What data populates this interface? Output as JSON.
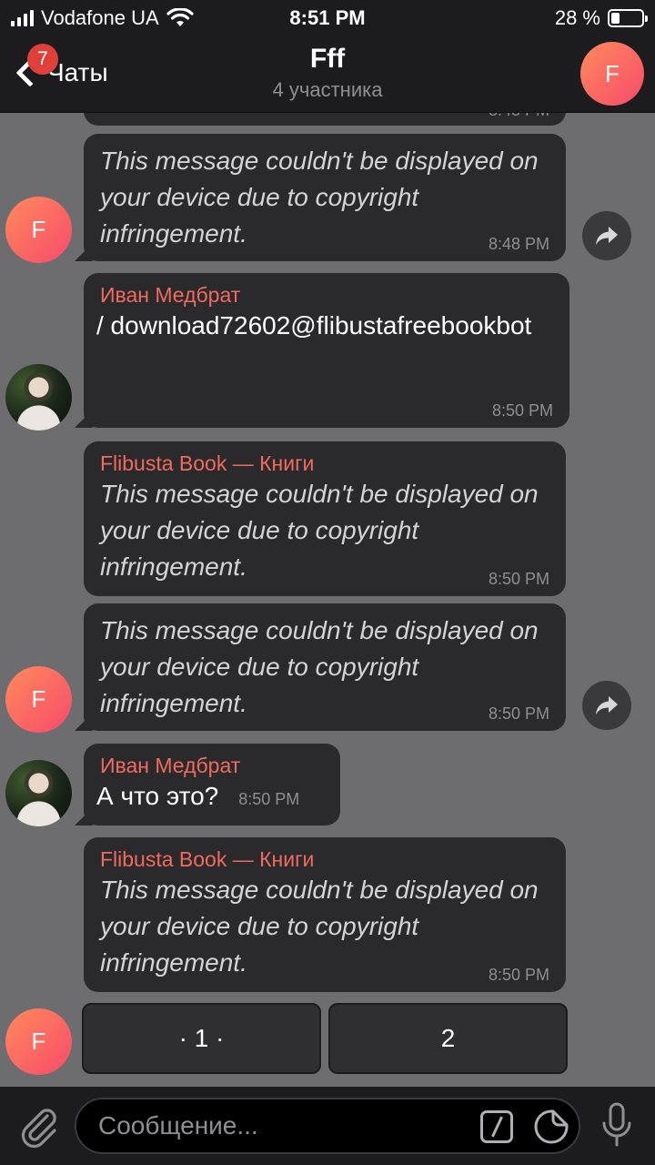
{
  "status_bar": {
    "carrier": "Vodafone UA",
    "time": "8:51 PM",
    "battery_percent": "28 %",
    "battery_level": 0.28
  },
  "header": {
    "back_label": "Чаты",
    "unread_count": "7",
    "title": "Fff",
    "subtitle": "4 участника",
    "avatar_letter": "F"
  },
  "messages": {
    "partial_time": "8:48 PM",
    "m1": {
      "text": "This message couldn't be displayed on your device due to copyright infringement.",
      "time": "8:48 PM",
      "avatar": "F"
    },
    "m2": {
      "sender": "Иван Медбрат",
      "text": "/ download72602@flibustafreebookbot",
      "time": "8:50 PM"
    },
    "m3": {
      "sender": "Flibusta Book — Книги",
      "text": "This message couldn't be displayed on your device due to copyright infringement.",
      "time": "8:50 PM"
    },
    "m4": {
      "text": "This message couldn't be displayed on your device due to copyright infringement.",
      "time": "8:50 PM",
      "avatar": "F"
    },
    "m5": {
      "sender": "Иван Медбрат",
      "text": "А что это?",
      "time": "8:50 PM"
    },
    "m6": {
      "sender": "Flibusta Book — Книги",
      "text": "This message couldn't be displayed on your device due to copyright infringement.",
      "time": "8:50 PM",
      "avatar": "F"
    }
  },
  "keyboard": {
    "buttons": [
      "· 1 ·",
      "2"
    ]
  },
  "input": {
    "placeholder": "Сообщение..."
  },
  "icons": {
    "back": "chevron-left-icon",
    "share": "share-arrow-icon",
    "attach": "paperclip-icon",
    "commands": "slash-command-icon",
    "stickers": "sticker-icon",
    "mic": "microphone-icon"
  },
  "colors": {
    "chat_background": "#6d6d6f",
    "bubble": "#2a2a2c",
    "sender_name": "#f16a5e",
    "badge": "#e0403a"
  }
}
